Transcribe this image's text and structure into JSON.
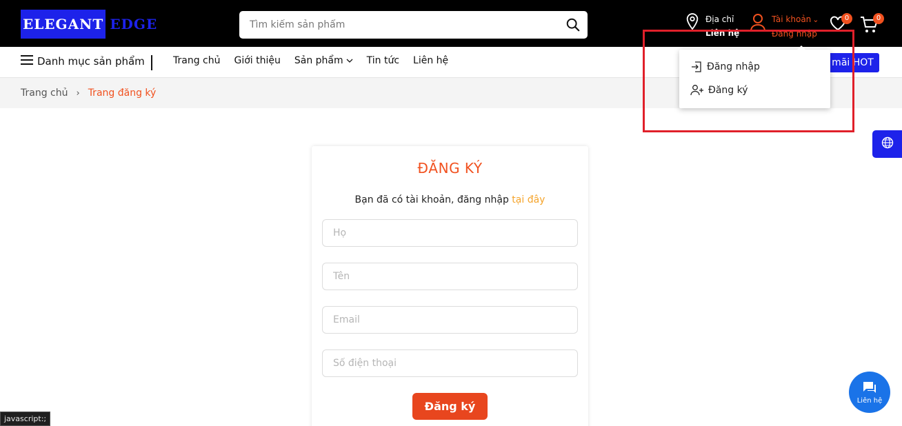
{
  "logo": {
    "part1": "ELEGANT",
    "part2": "EDGE"
  },
  "search": {
    "placeholder": "Tìm kiếm sản phẩm"
  },
  "header": {
    "address_line1": "Địa chỉ",
    "address_line2": "Liên hệ",
    "account_line1": "Tài khoản",
    "account_line2": "Đăng nhập",
    "wishlist_count": "0",
    "cart_count": "0"
  },
  "nav": {
    "category_menu": "Danh mục sản phẩm",
    "links": [
      "Trang chủ",
      "Giới thiệu",
      "Sản phẩm",
      "Tin tức",
      "Liên hệ"
    ],
    "hot_button": "a mãi HOT"
  },
  "breadcrumb": {
    "home": "Trang chủ",
    "current": "Trang đăng ký"
  },
  "dropdown": {
    "login": "Đăng nhập",
    "register": "Đăng ký"
  },
  "form": {
    "title": "ĐĂNG KÝ",
    "hint_text": "Bạn đã có tài khoản, đăng nhập ",
    "hint_link": "tại đây",
    "last_name_placeholder": "Họ",
    "first_name_placeholder": "Tên",
    "email_placeholder": "Email",
    "phone_placeholder": "Số điện thoại",
    "submit_label": "Đăng ký"
  },
  "chat": {
    "label": "Liên hệ"
  },
  "status_tip": "javascript:;",
  "colors": {
    "brand_blue": "#1d22ea",
    "accent_orange": "#f1511f",
    "link_gold": "#f5a42b",
    "highlight_red": "#e0202a"
  }
}
